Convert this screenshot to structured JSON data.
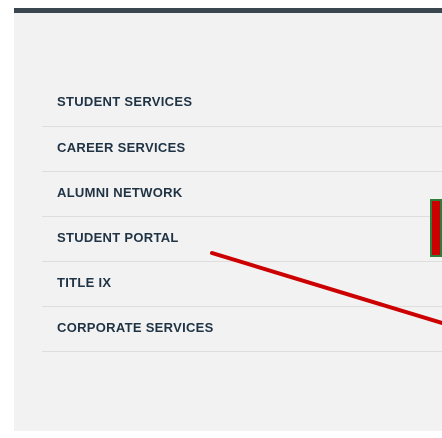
{
  "menu": {
    "items": [
      {
        "label": "STUDENT SERVICES"
      },
      {
        "label": "CAREER SERVICES"
      },
      {
        "label": "ALUMNI NETWORK"
      },
      {
        "label": "STUDENT PORTAL"
      },
      {
        "label": "TITLE IX"
      },
      {
        "label": "CORPORATE SERVICES"
      }
    ]
  },
  "colors": {
    "panel_bg": "#f2f2f2",
    "top_bar": "#3a4650",
    "link_text": "#1f3344",
    "annotation_line": "#cc0000",
    "annotation_bar": "#cc0000",
    "annotation_bar_edge": "#2e7d3a"
  }
}
